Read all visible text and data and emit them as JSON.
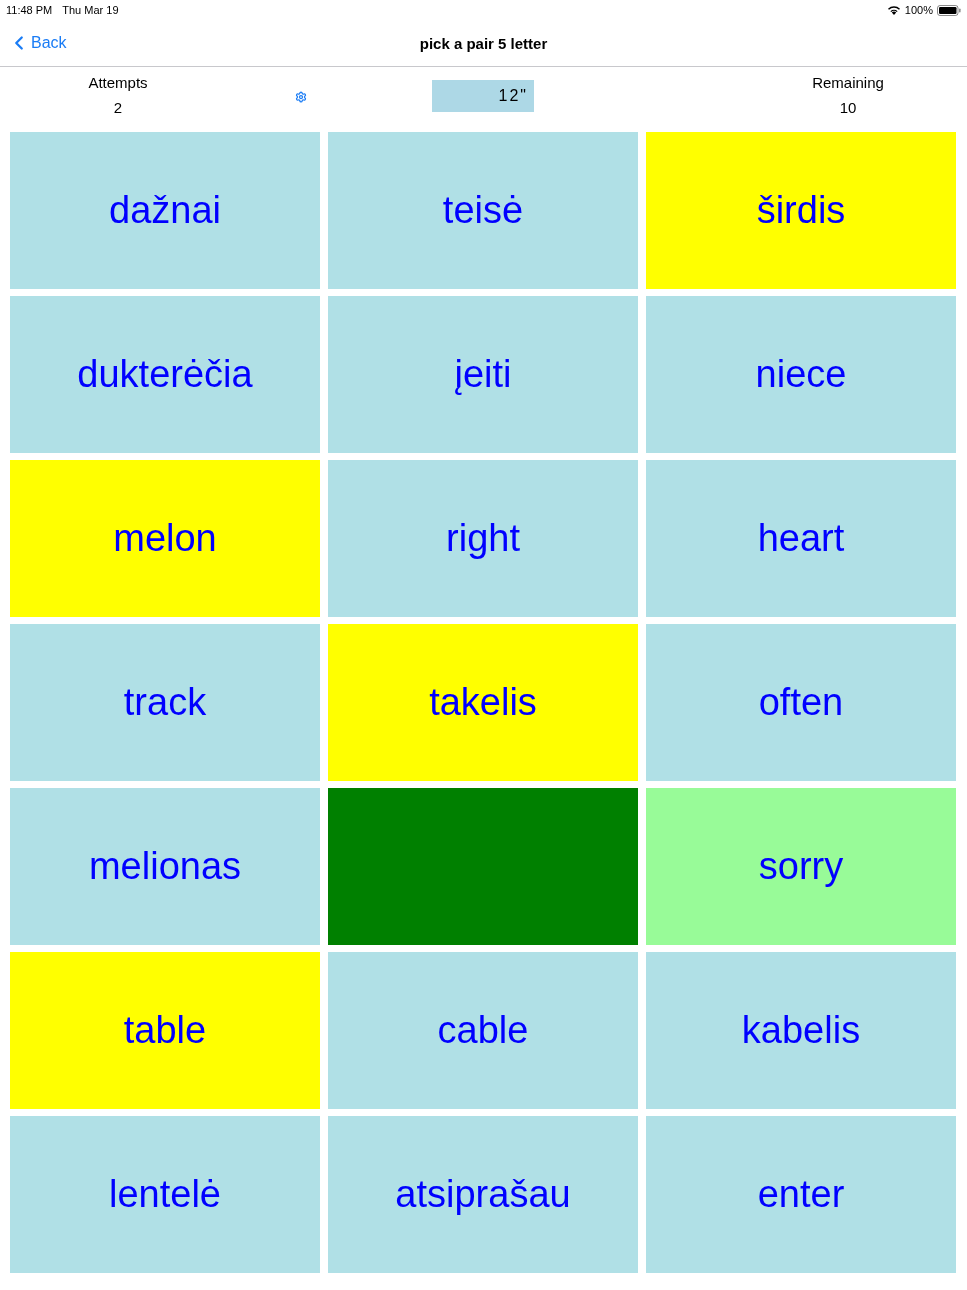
{
  "status_bar": {
    "time": "11:48 PM",
    "date": "Thu Mar 19",
    "battery_text": "100%"
  },
  "nav_bar": {
    "back_label": "Back",
    "title": "pick a pair 5 letter"
  },
  "stats": {
    "attempts": {
      "label": "Attempts",
      "value": "2"
    },
    "timer": "12\"",
    "remaining": {
      "label": "Remaining",
      "value": "10"
    }
  },
  "tiles": [
    {
      "label": "dažnai",
      "color": "#b0e0e6"
    },
    {
      "label": "teisė",
      "color": "#b0e0e6"
    },
    {
      "label": "širdis",
      "color": "#ffff00"
    },
    {
      "label": "dukterėčia",
      "color": "#b0e0e6"
    },
    {
      "label": "įeiti",
      "color": "#b0e0e6"
    },
    {
      "label": "niece",
      "color": "#b0e0e6"
    },
    {
      "label": "melon",
      "color": "#ffff00"
    },
    {
      "label": "right",
      "color": "#b0e0e6"
    },
    {
      "label": "heart",
      "color": "#b0e0e6"
    },
    {
      "label": "track",
      "color": "#b0e0e6"
    },
    {
      "label": "takelis",
      "color": "#ffff00"
    },
    {
      "label": "often",
      "color": "#b0e0e6"
    },
    {
      "label": "melionas",
      "color": "#b0e0e6"
    },
    {
      "color": "#008000"
    },
    {
      "label": "sorry",
      "color": "#98fb98"
    },
    {
      "label": "table",
      "color": "#ffff00"
    },
    {
      "label": "cable",
      "color": "#b0e0e6"
    },
    {
      "label": "kabelis",
      "color": "#b0e0e6"
    },
    {
      "label": "lentelė",
      "color": "#b0e0e6"
    },
    {
      "label": "atsiprašau",
      "color": "#b0e0e6"
    },
    {
      "label": "enter",
      "color": "#b0e0e6"
    }
  ]
}
